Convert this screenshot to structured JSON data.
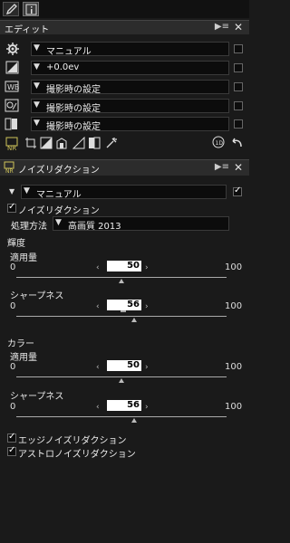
{
  "edit_panel": {
    "title": "エディット",
    "menu_label": "▶≡",
    "rows": [
      {
        "value": "マニュアル"
      },
      {
        "value": "+0.0ev"
      },
      {
        "value": "撮影時の設定"
      },
      {
        "value": "撮影時の設定"
      },
      {
        "value": "撮影時の設定"
      }
    ]
  },
  "nr_panel": {
    "title": "ノイズリダクション",
    "preset_value": "マニュアル",
    "nr_checkbox_label": "ノイズリダクション",
    "method_label": "処理方法",
    "method_value": "高画質 2013",
    "luminance": {
      "heading": "輝度",
      "amount_label": "適用量",
      "amount_min": "0",
      "amount_max": "100",
      "amount_value": "50",
      "sharpness_label": "シャープネス",
      "sharpness_min": "0",
      "sharpness_max": "100",
      "sharpness_value": "56"
    },
    "color": {
      "heading": "カラー",
      "amount_label": "適用量",
      "amount_min": "0",
      "amount_max": "100",
      "amount_value": "50",
      "sharpness_label": "シャープネス",
      "sharpness_min": "0",
      "sharpness_max": "100",
      "sharpness_value": "56"
    },
    "edge_nr_label": "エッジノイズリダクション",
    "astro_nr_label": "アストロノイズリダクション"
  }
}
